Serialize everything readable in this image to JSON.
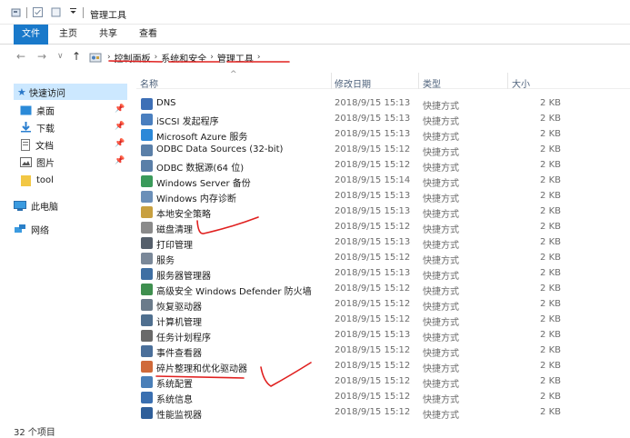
{
  "window": {
    "title": "管理工具"
  },
  "ribbon": {
    "tabs": [
      "文件",
      "主页",
      "共享",
      "查看"
    ]
  },
  "breadcrumb": [
    "控制面板",
    "系统和安全",
    "管理工具"
  ],
  "columns": {
    "name": "名称",
    "date": "修改日期",
    "type": "类型",
    "size": "大小"
  },
  "nav": {
    "quick_access": "快速访问",
    "items": [
      "桌面",
      "下载",
      "文档",
      "图片",
      "tool"
    ],
    "this_pc": "此电脑",
    "network": "网络"
  },
  "files": [
    {
      "name": "DNS",
      "date": "2018/9/15 15:13",
      "type": "快捷方式",
      "size": "2 KB",
      "icon_color": "#3d6fb6"
    },
    {
      "name": "iSCSI 发起程序",
      "date": "2018/9/15 15:13",
      "type": "快捷方式",
      "size": "2 KB",
      "icon_color": "#4a7fbf"
    },
    {
      "name": "Microsoft Azure 服务",
      "date": "2018/9/15 15:13",
      "type": "快捷方式",
      "size": "2 KB",
      "icon_color": "#2b88d8"
    },
    {
      "name": "ODBC Data Sources (32-bit)",
      "date": "2018/9/15 15:12",
      "type": "快捷方式",
      "size": "2 KB",
      "icon_color": "#5a7fa8"
    },
    {
      "name": "ODBC 数据源(64 位)",
      "date": "2018/9/15 15:12",
      "type": "快捷方式",
      "size": "2 KB",
      "icon_color": "#5a7fa8"
    },
    {
      "name": "Windows Server 备份",
      "date": "2018/9/15 15:14",
      "type": "快捷方式",
      "size": "2 KB",
      "icon_color": "#3a9a5a"
    },
    {
      "name": "Windows 内存诊断",
      "date": "2018/9/15 15:13",
      "type": "快捷方式",
      "size": "2 KB",
      "icon_color": "#6b8fb8"
    },
    {
      "name": "本地安全策略",
      "date": "2018/9/15 15:13",
      "type": "快捷方式",
      "size": "2 KB",
      "icon_color": "#c8a040"
    },
    {
      "name": "磁盘清理",
      "date": "2018/9/15 15:12",
      "type": "快捷方式",
      "size": "2 KB",
      "icon_color": "#8a8a8a"
    },
    {
      "name": "打印管理",
      "date": "2018/9/15 15:13",
      "type": "快捷方式",
      "size": "2 KB",
      "icon_color": "#555f6b"
    },
    {
      "name": "服务",
      "date": "2018/9/15 15:12",
      "type": "快捷方式",
      "size": "2 KB",
      "icon_color": "#7a8899"
    },
    {
      "name": "服务器管理器",
      "date": "2018/9/15 15:13",
      "type": "快捷方式",
      "size": "2 KB",
      "icon_color": "#3f6fa3"
    },
    {
      "name": "高级安全 Windows Defender 防火墙",
      "date": "2018/9/15 15:12",
      "type": "快捷方式",
      "size": "2 KB",
      "icon_color": "#3f8f4f"
    },
    {
      "name": "恢复驱动器",
      "date": "2018/9/15 15:12",
      "type": "快捷方式",
      "size": "2 KB",
      "icon_color": "#6b7b8b"
    },
    {
      "name": "计算机管理",
      "date": "2018/9/15 15:12",
      "type": "快捷方式",
      "size": "2 KB",
      "icon_color": "#4f6f8f"
    },
    {
      "name": "任务计划程序",
      "date": "2018/9/15 15:13",
      "type": "快捷方式",
      "size": "2 KB",
      "icon_color": "#6a6a6a"
    },
    {
      "name": "事件查看器",
      "date": "2018/9/15 15:12",
      "type": "快捷方式",
      "size": "2 KB",
      "icon_color": "#4a6f9a"
    },
    {
      "name": "碎片整理和优化驱动器",
      "date": "2018/9/15 15:12",
      "type": "快捷方式",
      "size": "2 KB",
      "icon_color": "#d06a3a"
    },
    {
      "name": "系统配置",
      "date": "2018/9/15 15:12",
      "type": "快捷方式",
      "size": "2 KB",
      "icon_color": "#4a7fb8"
    },
    {
      "name": "系统信息",
      "date": "2018/9/15 15:12",
      "type": "快捷方式",
      "size": "2 KB",
      "icon_color": "#3a6fb0"
    },
    {
      "name": "性能监视器",
      "date": "2018/9/15 15:12",
      "type": "快捷方式",
      "size": "2 KB",
      "icon_color": "#2f5f9a"
    }
  ],
  "status": {
    "count": "32 个项目"
  },
  "annotation_color": "#e0201f"
}
